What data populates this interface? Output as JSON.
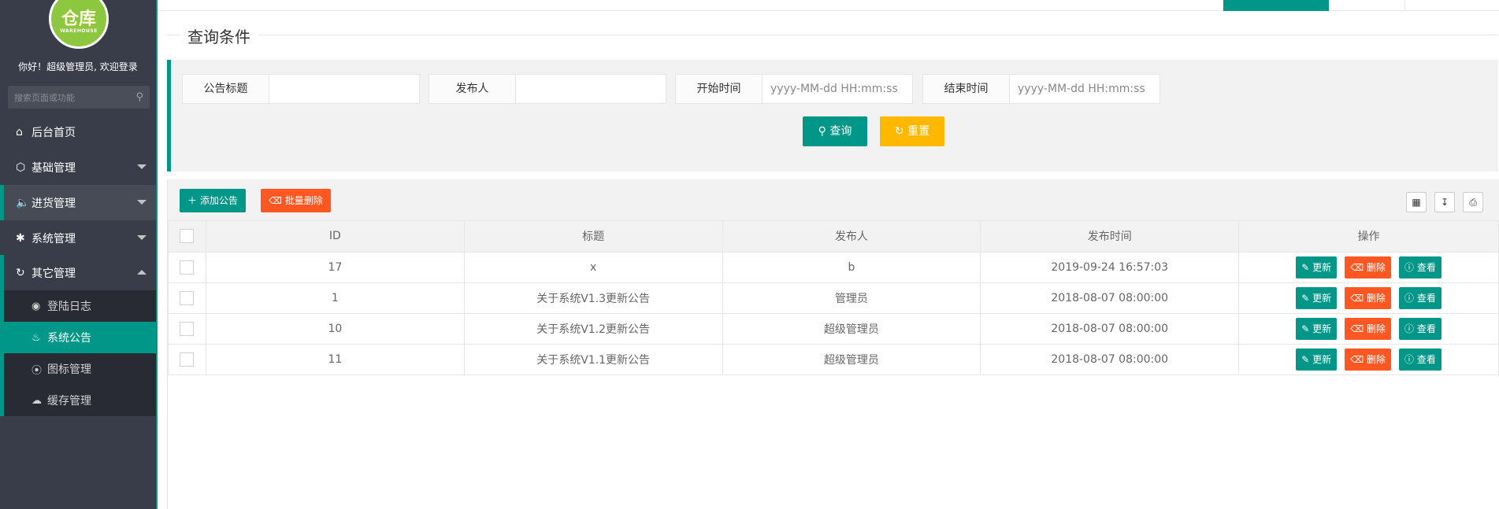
{
  "sidebar": {
    "logo_glyph": "仓库",
    "logo_sub": "WAREHOUSE",
    "welcome": "你好！超级管理员, 欢迎登录",
    "search_placeholder": "搜索页面或功能",
    "menu": [
      {
        "label": "后台首页",
        "icon": "home-icon"
      },
      {
        "label": "基础管理",
        "icon": "cube-icon"
      },
      {
        "label": "进货管理",
        "icon": "speaker-icon"
      },
      {
        "label": "系统管理",
        "icon": "gear-icon"
      },
      {
        "label": "其它管理",
        "icon": "refresh-icon"
      }
    ],
    "submenu": [
      {
        "label": "登陆日志",
        "icon": "eye-icon"
      },
      {
        "label": "系统公告",
        "icon": "fire-icon"
      },
      {
        "label": "图标管理",
        "icon": "compass-icon"
      },
      {
        "label": "缓存管理",
        "icon": "cloud-icon"
      }
    ]
  },
  "page": {
    "legend_title": "查询条件"
  },
  "query": {
    "fields": [
      {
        "label": "公告标题",
        "value": ""
      },
      {
        "label": "发布人",
        "value": ""
      },
      {
        "label": "开始时间",
        "placeholder": "yyyy-MM-dd HH:mm:ss"
      },
      {
        "label": "结束时间",
        "placeholder": "yyyy-MM-dd HH:mm:ss"
      }
    ],
    "search_label": "查询",
    "reset_label": "重置"
  },
  "toolbar": {
    "add_label": "添加公告",
    "batch_delete_label": "批量删除"
  },
  "table": {
    "columns": [
      "ID",
      "标题",
      "发布人",
      "发布时间",
      "操作"
    ],
    "rows": [
      {
        "id": "17",
        "title": "x",
        "publisher": "b",
        "time": "2019-09-24 16:57:03"
      },
      {
        "id": "1",
        "title": "关于系统V1.3更新公告",
        "publisher": "管理员",
        "time": "2018-08-07 08:00:00"
      },
      {
        "id": "10",
        "title": "关于系统V1.2更新公告",
        "publisher": "超级管理员",
        "time": "2018-08-07 08:00:00"
      },
      {
        "id": "11",
        "title": "关于系统V1.1更新公告",
        "publisher": "超级管理员",
        "time": "2018-08-07 08:00:00"
      }
    ],
    "actions": {
      "update": "更新",
      "delete": "删除",
      "view": "查看"
    }
  },
  "colors": {
    "accent": "#009688",
    "warn": "#ffb800",
    "danger": "#ff5722",
    "sidebar": "#393d49"
  }
}
